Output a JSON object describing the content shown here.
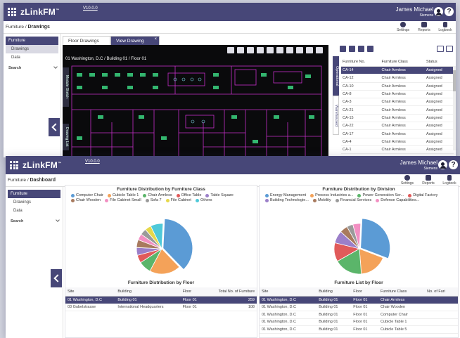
{
  "back": {
    "app_name": "zLinkFM",
    "version": "V10.0.0",
    "user_name": "James Michael",
    "user_org": "Siemens",
    "crumb_parent": "Furniture / ",
    "crumb_page": "Drawings",
    "tools": [
      "Settings",
      "Reports",
      "Logbook"
    ],
    "sidebar": {
      "head": "Furniture",
      "items": [
        "Drawings",
        "Data"
      ],
      "search": "Search"
    },
    "tabs": [
      "Floor Drawings",
      "View Drawing"
    ],
    "tab_close": "×",
    "drawing_path": "01 Washington, D.C / Building 01 / Floor 01",
    "drawing_vtab_top": "Module Sketch",
    "drawing_vtab_bottom": "Drawing List",
    "vtab_operational": "Operational",
    "vtab_warehoused": "Warehoused",
    "furniture_table": {
      "columns": [
        "Furniture No.",
        "Furniture Class",
        "Status"
      ],
      "rows": [
        [
          "CA-14",
          "Chair Armless",
          "Assigned"
        ],
        [
          "CA-12",
          "Chair Armless",
          "Assigned"
        ],
        [
          "CA-10",
          "Chair Armless",
          "Assigned"
        ],
        [
          "CA-8",
          "Chair Armless",
          "Assigned"
        ],
        [
          "CA-3",
          "Chair Armless",
          "Assigned"
        ],
        [
          "CA-21",
          "Chair Armless",
          "Assigned"
        ],
        [
          "CA-15",
          "Chair Armless",
          "Assigned"
        ],
        [
          "CA-22",
          "Chair Armless",
          "Assigned"
        ],
        [
          "CA-17",
          "Chair Armless",
          "Assigned"
        ],
        [
          "CA-4",
          "Chair Armless",
          "Assigned"
        ],
        [
          "CA-1",
          "Chair Armless",
          "Assigned"
        ]
      ]
    }
  },
  "front": {
    "app_name": "zLinkFM",
    "version": "V10.0.0",
    "user_name": "James Michael",
    "user_org": "Siemens",
    "crumb_parent": "Furniture / ",
    "crumb_page": "Dashboard",
    "tools": [
      "Settings",
      "Reports",
      "Logbook"
    ],
    "sidebar": {
      "head": "Furniture",
      "items": [
        "Drawings",
        "Data"
      ],
      "search": "Search"
    },
    "floor_table": {
      "title": "Furniture Distribution by Floor",
      "columns": [
        "Site",
        "Building",
        "Floor",
        "Total No. of Furniture"
      ],
      "rows": [
        [
          "01 Washington, D.C",
          "Building 01",
          "Floor 01",
          "259"
        ],
        [
          "03 Gubelstrasse",
          "International Headquarters",
          "Floor 01",
          "108"
        ]
      ]
    },
    "list_table": {
      "title": "Furniture List by Floor",
      "columns": [
        "Site",
        "Building",
        "Floor",
        "Furniture Class",
        "No. of Furi"
      ],
      "rows": [
        [
          "01 Washington, D.C",
          "Building 01",
          "Floor 01",
          "Chair Armless",
          ""
        ],
        [
          "01 Washington, D.C",
          "Building 01",
          "Floor 01",
          "Chair Wooden",
          ""
        ],
        [
          "01 Washington, D.C",
          "Building 01",
          "Floor 01",
          "Computer Chair",
          ""
        ],
        [
          "01 Washington, D.C",
          "Building 01",
          "Floor 01",
          "Cubicle Table 1",
          ""
        ],
        [
          "01 Washington, D.C",
          "Building 01",
          "Floor 01",
          "Cubicle Table 5",
          ""
        ]
      ]
    }
  },
  "chart_data": [
    {
      "type": "pie",
      "title": "Furniture Distribution by Furniture Class",
      "series": [
        {
          "name": "Computer Chair",
          "color": "#5b9bd5",
          "value": 37
        },
        {
          "name": "Cubicle Table 1",
          "color": "#f4a259",
          "value": 20
        },
        {
          "name": "Chair Armless",
          "color": "#5bb56a",
          "value": 8
        },
        {
          "name": "Office Table",
          "color": "#e05a5a",
          "value": 5
        },
        {
          "name": "Table Square",
          "color": "#9b7fc9",
          "value": 5
        },
        {
          "name": "Chair Wooden",
          "color": "#a87a5e",
          "value": 5
        },
        {
          "name": "File Cabinet Small",
          "color": "#f28fc2",
          "value": 4
        },
        {
          "name": "Sofa 7",
          "color": "#9a9a9a",
          "value": 4
        },
        {
          "name": "File Cabinet",
          "color": "#e6d84a",
          "value": 4
        },
        {
          "name": "Others",
          "color": "#4fc9d9",
          "value": 8
        }
      ]
    },
    {
      "type": "pie",
      "title": "Furniture Distribution by Division",
      "series": [
        {
          "name": "Energy Management",
          "color": "#5b9bd5",
          "value": 30
        },
        {
          "name": "Process Industries a...",
          "color": "#f4a259",
          "value": 18
        },
        {
          "name": "Power Generation Ser...",
          "color": "#5bb56a",
          "value": 18
        },
        {
          "name": "Digital Factory",
          "color": "#e05a5a",
          "value": 12
        },
        {
          "name": "Building Technologie...",
          "color": "#9b7fc9",
          "value": 8
        },
        {
          "name": "Mobility",
          "color": "#a87a5e",
          "value": 5
        },
        {
          "name": "Financial Services",
          "color": "#9a9a9a",
          "value": 4
        },
        {
          "name": "Defense Capabilities...",
          "color": "#f28fc2",
          "value": 5
        }
      ]
    }
  ]
}
